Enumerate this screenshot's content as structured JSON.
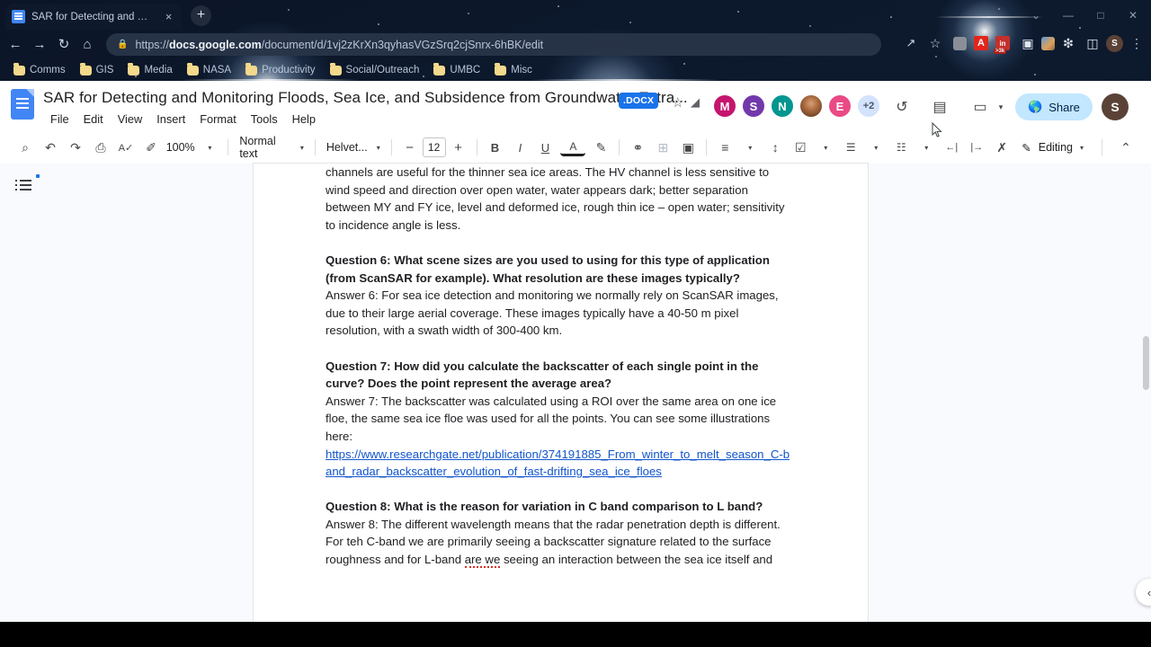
{
  "browser": {
    "tab": {
      "title": "SAR for Detecting and Monitori",
      "close_label": "×",
      "favicon": "google-docs-favicon"
    },
    "newtab_label": "+",
    "window_controls": {
      "chevron": "⌄",
      "minimize": "—",
      "maximize": "□",
      "close": "✕"
    },
    "nav": {
      "back": "←",
      "forward": "→",
      "reload": "↻",
      "home": "⌂"
    },
    "omnibox": {
      "lock_icon": "🔒",
      "scheme": "https://",
      "host": "docs.google.com",
      "path": "/document/d/1vj2zKrXn3qyhasVGzSrq2cjSnrx-6hBK/edit",
      "full_url": "https://docs.google.com/document/d/1vj2zKrXn3qyhasVGzSrq2cjSnrx-6hBK/edit"
    },
    "omnibox_actions": {
      "share": "⤴",
      "bookmark": "☆"
    },
    "extensions": [
      {
        "name": "grey-extension-icon",
        "glyph": "▤",
        "color": "#8a8f98"
      },
      {
        "name": "adobe-acrobat-icon",
        "glyph": "A",
        "color": "#e1251b"
      },
      {
        "name": "notification-count-icon",
        "glyph": "in",
        "badge": ">3k",
        "color": "#c4302b"
      },
      {
        "name": "picture-in-picture-icon",
        "glyph": "▣",
        "color": "#dfe6ef"
      },
      {
        "name": "colorful-extension-icon",
        "glyph": "◔",
        "color": "#e0a05a"
      },
      {
        "name": "extensions-puzzle-icon",
        "glyph": "✷",
        "color": "#dfe6ef"
      },
      {
        "name": "side-panel-icon",
        "glyph": "◫",
        "color": "#dfe6ef"
      }
    ],
    "profile_avatar": "S",
    "overflow_menu": "⋮",
    "bookmarks": [
      {
        "label": "Comms"
      },
      {
        "label": "GIS"
      },
      {
        "label": "Media"
      },
      {
        "label": "NASA"
      },
      {
        "label": "Productivity"
      },
      {
        "label": "Social/Outreach"
      },
      {
        "label": "UMBC"
      },
      {
        "label": "Misc"
      }
    ]
  },
  "docs": {
    "title": "SAR for Detecting and Monitoring Floods, Sea Ice, and Subsidence from Groundwater Extra...",
    "format_badge": ".DOCX",
    "star_icon": "☆",
    "move_icon": "◢",
    "menus": [
      "File",
      "Edit",
      "View",
      "Insert",
      "Format",
      "Tools",
      "Help"
    ],
    "collaborators": [
      {
        "initial": "M",
        "color": "#c5156e"
      },
      {
        "initial": "S",
        "color": "#7239ab"
      },
      {
        "initial": "N",
        "color": "#00968f"
      },
      {
        "initial": "",
        "color": "photo"
      },
      {
        "initial": "E",
        "color": "#ea4a86"
      }
    ],
    "collaborators_overflow": "+2",
    "header_actions": {
      "version_history": "↺",
      "comments": "▤",
      "meet": "▭",
      "meet_caret": "▾"
    },
    "share_label": "Share",
    "share_icon": "🌐",
    "account_avatar": "S",
    "toolbar": {
      "search": "⌕",
      "undo": "↶",
      "redo": "↷",
      "print": "⎙",
      "spellcheck": "A✓",
      "paint_format": "✐",
      "zoom": "100%",
      "style": "Normal text",
      "font": "Helvet...",
      "font_decrease": "−",
      "font_size": "12",
      "font_increase": "+",
      "bold": "B",
      "italic": "I",
      "underline": "U",
      "text_color": "A",
      "highlight": "✎",
      "link": "⚭",
      "comment": "⊞",
      "image": "▣",
      "align": "≡",
      "line_spacing": "↕",
      "checklist": "☑",
      "bulleted_list": "☰",
      "numbered_list": "☷",
      "decrease_indent": "←|",
      "increase_indent": "|→",
      "clear_formatting": "✗",
      "mode_label": "Editing",
      "mode_icon": "✎",
      "mode_caret": "▾",
      "collapse": "⌃"
    },
    "outline_icon": "document-outline-icon",
    "content": {
      "paragraphs": [
        {
          "type": "body",
          "text": "channels are useful for the thinner sea ice areas. The HV channel is less sensitive to wind speed and direction over open water, water appears dark; better separation between MY and FY ice, level and deformed ice, rough thin ice – open water; sensitivity to incidence angle is less."
        },
        {
          "type": "question",
          "text": "Question 6: What scene sizes are you used to using for this type of application (from ScanSAR for example). What resolution are these images typically?"
        },
        {
          "type": "body",
          "text": "Answer 6: For sea ice detection and monitoring we normally rely on ScanSAR images, due to their large aerial coverage. These images typically have a 40-50 m pixel resolution, with a swath width of 300-400 km."
        },
        {
          "type": "question",
          "text": "Question 7: How did you calculate the backscatter of each single point in the curve? Does the point represent the average area?"
        },
        {
          "type": "body",
          "text": "Answer 7: The backscatter was calculated using a ROI over the same area on one ice floe, the same sea ice floe was used for all the points. You can see some illustrations here:"
        },
        {
          "type": "link",
          "text": "https://www.researchgate.net/publication/374191885_From_winter_to_melt_season_C-band_radar_backscatter_evolution_of_fast-drifting_sea_ice_floes"
        },
        {
          "type": "question",
          "text": "Question 8: What is the reason for variation in C band comparison to L band?"
        },
        {
          "type": "body_q8_a",
          "text": "Answer 8: The different wavelength means that the radar penetration depth is different. For teh C-band we are primarily seeing a backscatter signature related to the surface roughness and for L-band "
        },
        {
          "type": "misspelled",
          "text": "are we"
        },
        {
          "type": "body_q8_b",
          "text": " seeing an interaction between the sea ice itself and"
        }
      ]
    },
    "scroll_chevron": "‹"
  }
}
